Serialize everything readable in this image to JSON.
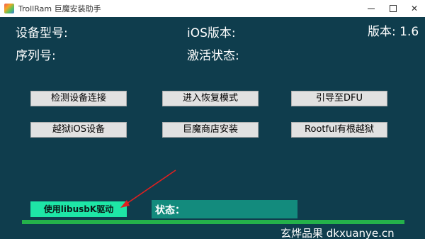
{
  "window": {
    "title": "TrollRam 巨魔安装助手",
    "icon": "app-logo-icon",
    "controls": {
      "minimize": "minimize-icon",
      "maximize": "maximize-icon",
      "close_glyph": "✕"
    }
  },
  "info": {
    "device_model_label": "设备型号:",
    "ios_version_label": "iOS版本:",
    "app_version": "版本: 1.6",
    "serial_label": "序列号:",
    "activation_label": "激活状态:"
  },
  "buttons": {
    "detect": "检测设备连接",
    "recovery": "进入恢复模式",
    "dfu": "引导至DFU",
    "jailbreak": "越狱iOS设备",
    "trollstore": "巨魔商店安装",
    "rootful": "Rootful有根越狱"
  },
  "driver_button": "使用libusbK驱动",
  "status": {
    "label": "状态："
  },
  "progress": {
    "percent": 100
  },
  "footer": "玄烨品果  dkxuanye.cn",
  "colors": {
    "background": "#0f3d4d",
    "button": "#e1e1e1",
    "driver_button": "#1ee6a6",
    "status_bar": "#138b7d",
    "progress": "#24b14a",
    "annotation_arrow": "#e02020"
  }
}
